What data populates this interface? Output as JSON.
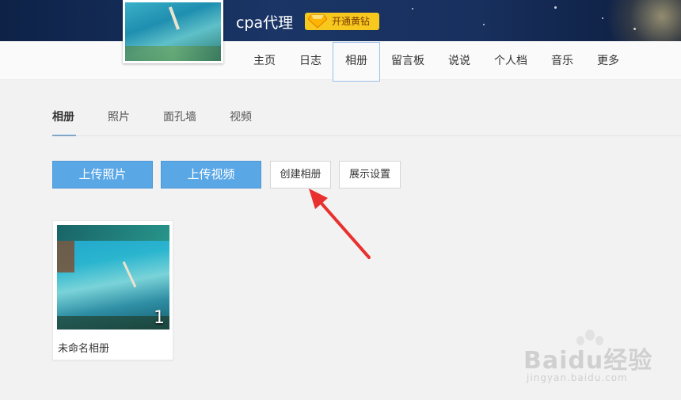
{
  "header": {
    "site_title": "cpa代理",
    "vip_label": "开通黄钻"
  },
  "nav": {
    "items": [
      {
        "label": "主页"
      },
      {
        "label": "日志"
      },
      {
        "label": "相册",
        "active": true
      },
      {
        "label": "留言板"
      },
      {
        "label": "说说"
      },
      {
        "label": "个人档"
      },
      {
        "label": "音乐"
      },
      {
        "label": "更多"
      }
    ]
  },
  "tabs": [
    {
      "label": "相册",
      "active": true
    },
    {
      "label": "照片"
    },
    {
      "label": "面孔墙"
    },
    {
      "label": "视频"
    }
  ],
  "toolbar": {
    "upload_photo": "上传照片",
    "upload_video": "上传视频",
    "create_album": "创建相册",
    "display_settings": "展示设置"
  },
  "albums": [
    {
      "name": "未命名相册",
      "count": "1"
    }
  ],
  "watermark": {
    "brand": "Baidu经验",
    "url": "jingyan.baidu.com"
  },
  "colors": {
    "accent_blue": "#5aa7e6",
    "vip_yellow": "#f7c81e",
    "arrow_red": "#e8312f"
  }
}
